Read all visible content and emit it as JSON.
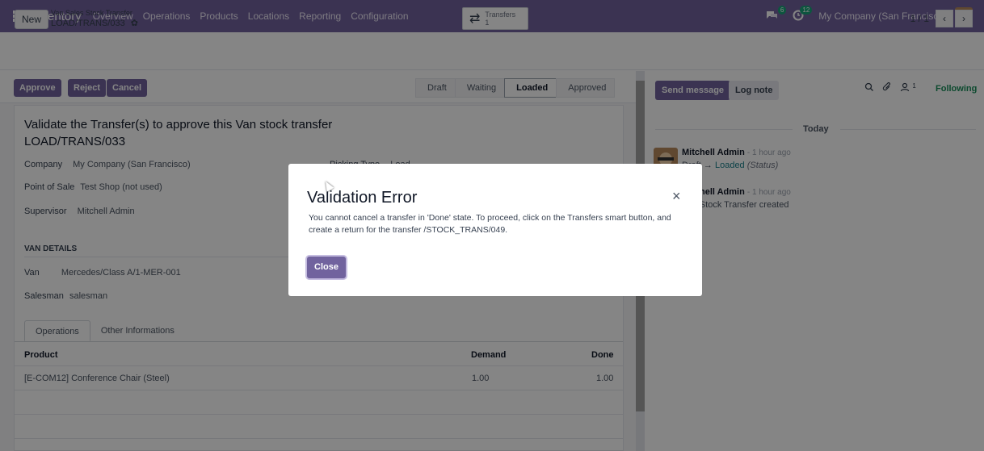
{
  "topnav": {
    "app_name": "Inventory",
    "menu": [
      "Overview",
      "Operations",
      "Products",
      "Locations",
      "Reporting",
      "Configuration"
    ],
    "messages_badge": "6",
    "activities_badge": "12",
    "company": "My Company (San Francisco)",
    "brand_color": "#71639e"
  },
  "control": {
    "new_label": "New",
    "breadcrumb_parent": "Van Sales Stock Transfer",
    "breadcrumb_current": "LOAD/TRANS/033",
    "smart_button_label": "Transfers",
    "smart_button_count": "1",
    "pager": "1 / 1"
  },
  "statusbar": {
    "approve": "Approve",
    "reject": "Reject",
    "cancel": "Cancel",
    "states": [
      "Draft",
      "Waiting",
      "Loaded",
      "Approved"
    ],
    "active_state": "Loaded"
  },
  "form": {
    "title_line1": "Validate the Transfer(s) to approve this Van stock transfer",
    "title_line2": "LOAD/TRANS/033",
    "company_label": "Company",
    "company_value": "My Company (San Francisco)",
    "picking_type_label": "Picking Type",
    "picking_type_value": "Load",
    "pos_label": "Point of Sale",
    "pos_value": "Test Shop (not used)",
    "supervisor_label": "Supervisor",
    "supervisor_value": "Mitchell Admin",
    "van_details": "VAN DETAILS",
    "van_label": "Van",
    "van_value": "Mercedes/Class A/1-MER-001",
    "salesman_label": "Salesman",
    "salesman_value": "salesman",
    "tabs": [
      "Operations",
      "Other Informations"
    ],
    "table": {
      "headers": [
        "Product",
        "Demand",
        "Done"
      ],
      "rows": [
        [
          "[E-COM12] Conference Chair (Steel)",
          "1.00",
          "1.00"
        ]
      ]
    }
  },
  "chatter": {
    "send_message": "Send message",
    "log_note": "Log note",
    "followers_count": "1",
    "following": "Following",
    "today": "Today",
    "messages": [
      {
        "author": "Mitchell Admin",
        "time": "- 1 hour ago",
        "old": "Draft",
        "arrow": "→",
        "new": "Loaded",
        "field": "(Status)"
      },
      {
        "author": "Mitchell Admin",
        "time": "- 1 hour ago",
        "text": "Van Stock Transfer created"
      }
    ]
  },
  "modal": {
    "title": "Validation Error",
    "body": "You cannot cancel a transfer in 'Done' state. To proceed, click on the Transfers smart button, and create a return for the transfer /STOCK_TRANS/049.",
    "close_label": "Close",
    "close_icon": "×"
  }
}
